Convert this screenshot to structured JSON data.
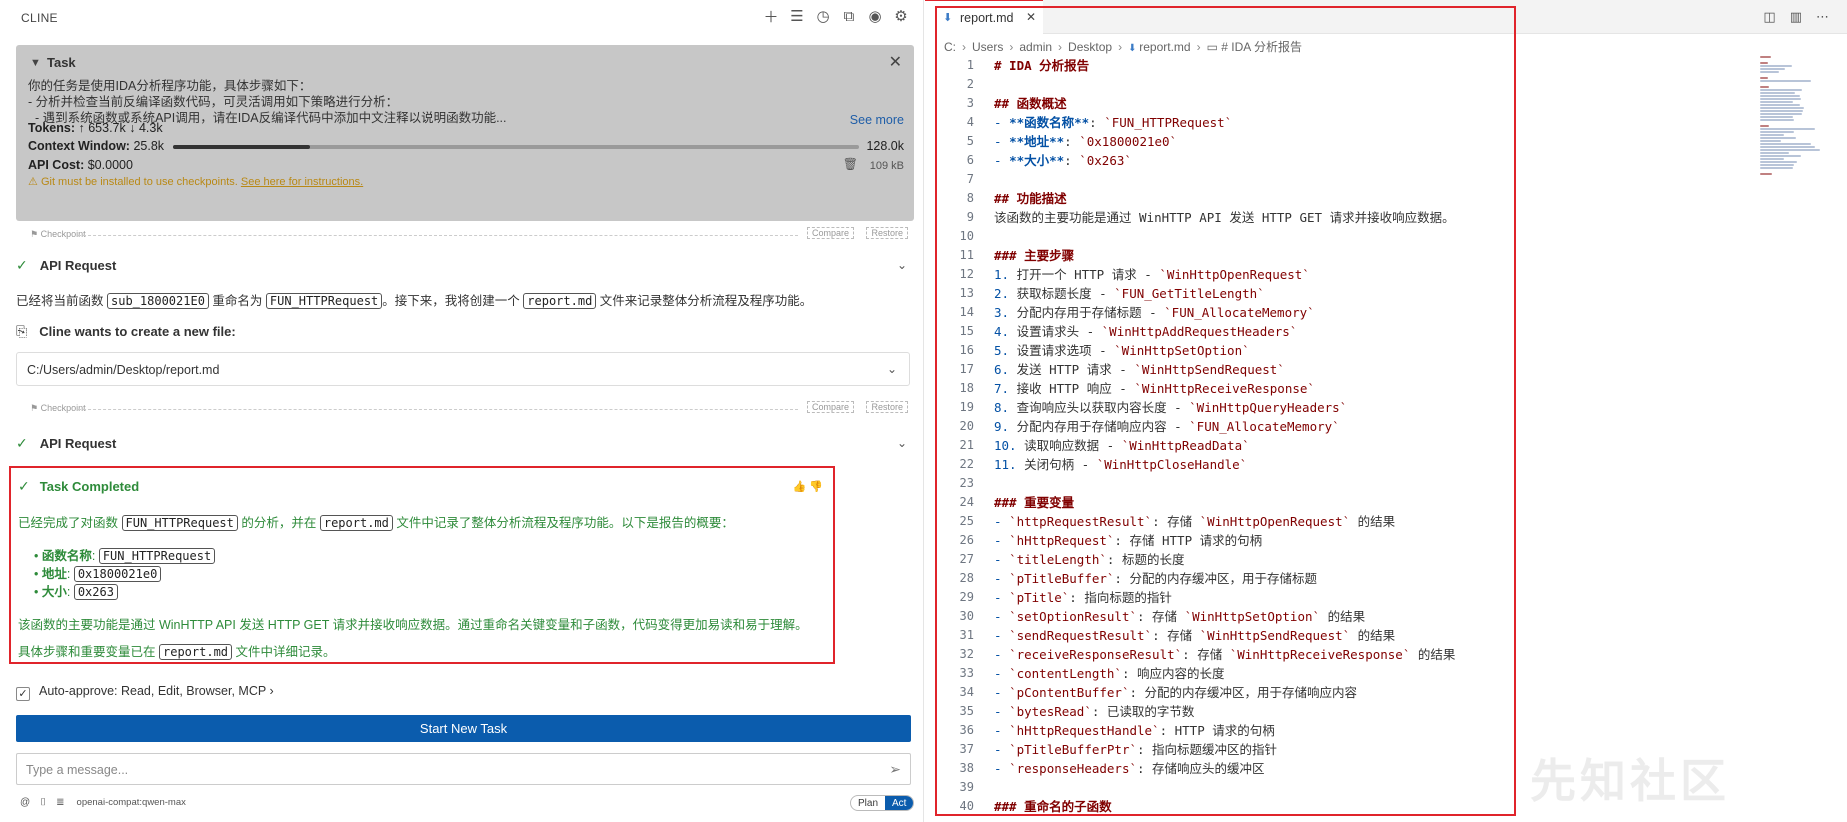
{
  "sidebar_header": {
    "title": "CLINE",
    "icons": [
      "plus-icon",
      "history-list-icon",
      "clock-history-icon",
      "popout-icon",
      "account-icon",
      "gear-icon"
    ]
  },
  "task": {
    "label": "Task",
    "desc_lines": [
      "你的任务是使用IDA分析程序功能，具体步骤如下：",
      "- 分析并检查当前反编译函数代码，可灵活调用如下策略进行分析：",
      "  - 遇到系统函数或系统API调用，请在IDA反编译代码中添加中文注释以说明函数功能..."
    ],
    "see_more": "See more",
    "tokens_label": "Tokens:",
    "tokens_up": "↑ 653.7k",
    "tokens_down": "↓ 4.3k",
    "context_label": "Context Window:",
    "context_used": "25.8k",
    "context_max": "128.0k",
    "context_fraction": 0.2,
    "api_cost_label": "API Cost:",
    "api_cost": "$0.0000",
    "size": "109 kB",
    "git_warning": "Git must be installed to use checkpoints.",
    "git_link": "See here for instructions."
  },
  "checkpoint": {
    "label": "Checkpoint",
    "compare": "Compare",
    "restore": "Restore"
  },
  "messages": {
    "api_request_1": "API Request",
    "rename_before": "已经将当前函数",
    "rename_old": "sub_1800021E0",
    "rename_mid": "重命名为",
    "rename_new": "FUN_HTTPRequest",
    "rename_after_1": "。接下来，我将创建一个",
    "rename_file": "report.md",
    "rename_after_2": "文件来记录整体分析流程及程序功能。",
    "create_file_title": "Cline wants to create a new file:",
    "file_path": "C:/Users/admin/Desktop/report.md",
    "api_request_2": "API Request"
  },
  "completed": {
    "title": "Task Completed",
    "line1_a": "已经完成了对函数",
    "line1_fn": "FUN_HTTPRequest",
    "line1_b": "的分析，并在",
    "line1_file": "report.md",
    "line1_c": "文件中记录了整体分析流程及程序功能。以下是报告的概要：",
    "b1_label": "函数名称",
    "b1_val": "FUN_HTTPRequest",
    "b2_label": "地址",
    "b2_val": "0x1800021e0",
    "b3_label": "大小",
    "b3_val": "0x263",
    "summary": "该函数的主要功能是通过 WinHTTP API 发送 HTTP GET 请求并接收响应数据。通过重命名关键变量和子函数，代码变得更加易读和易于理解。",
    "final_a": "具体步骤和重要变量已在",
    "final_file": "report.md",
    "final_b": "文件中详细记录。"
  },
  "auto_approve": "Auto-approve: Read, Edit, Browser, MCP",
  "start_new_task": "Start New Task",
  "message_placeholder": "Type a message...",
  "model": "openai-compat:qwen-max",
  "plan_label": "Plan",
  "act_label": "Act",
  "editor": {
    "tab_name": "report.md",
    "breadcrumbs": [
      "C:",
      "Users",
      "admin",
      "Desktop",
      "report.md",
      "# IDA 分析报告"
    ],
    "lines": [
      "# IDA 分析报告",
      "",
      "## 函数概述",
      "- **函数名称**: `FUN_HTTPRequest`",
      "- **地址**: `0x1800021e0`",
      "- **大小**: `0x263`",
      "",
      "## 功能描述",
      "该函数的主要功能是通过 WinHTTP API 发送 HTTP GET 请求并接收响应数据。",
      "",
      "### 主要步骤",
      "1. 打开一个 HTTP 请求 - `WinHttpOpenRequest`",
      "2. 获取标题长度 - `FUN_GetTitleLength`",
      "3. 分配内存用于存储标题 - `FUN_AllocateMemory`",
      "4. 设置请求头 - `WinHttpAddRequestHeaders`",
      "5. 设置请求选项 - `WinHttpSetOption`",
      "6. 发送 HTTP 请求 - `WinHttpSendRequest`",
      "7. 接收 HTTP 响应 - `WinHttpReceiveResponse`",
      "8. 查询响应头以获取内容长度 - `WinHttpQueryHeaders`",
      "9. 分配内存用于存储响应内容 - `FUN_AllocateMemory`",
      "10. 读取响应数据 - `WinHttpReadData`",
      "11. 关闭句柄 - `WinHttpCloseHandle`",
      "",
      "### 重要变量",
      "- `httpRequestResult`: 存储 `WinHttpOpenRequest` 的结果",
      "- `hHttpRequest`: 存储 HTTP 请求的句柄",
      "- `titleLength`: 标题的长度",
      "- `pTitleBuffer`: 分配的内存缓冲区，用于存储标题",
      "- `pTitle`: 指向标题的指针",
      "- `setOptionResult`: 存储 `WinHttpSetOption` 的结果",
      "- `sendRequestResult`: 存储 `WinHttpSendRequest` 的结果",
      "- `receiveResponseResult`: 存储 `WinHttpReceiveResponse` 的结果",
      "- `contentLength`: 响应内容的长度",
      "- `pContentBuffer`: 分配的内存缓冲区，用于存储响应内容",
      "- `bytesRead`: 已读取的字节数",
      "- `hHttpRequestHandle`: HTTP 请求的句柄",
      "- `pTitleBufferPtr`: 指向标题缓冲区的指针",
      "- `responseHeaders`: 存储响应头的缓冲区",
      "",
      "### 重命名的子函数"
    ]
  },
  "watermark": "先知社区",
  "colors": {
    "accent": "#0b5cad",
    "success": "#2e8b3a",
    "highlight_border": "#e0242b",
    "warning": "#b98916"
  }
}
